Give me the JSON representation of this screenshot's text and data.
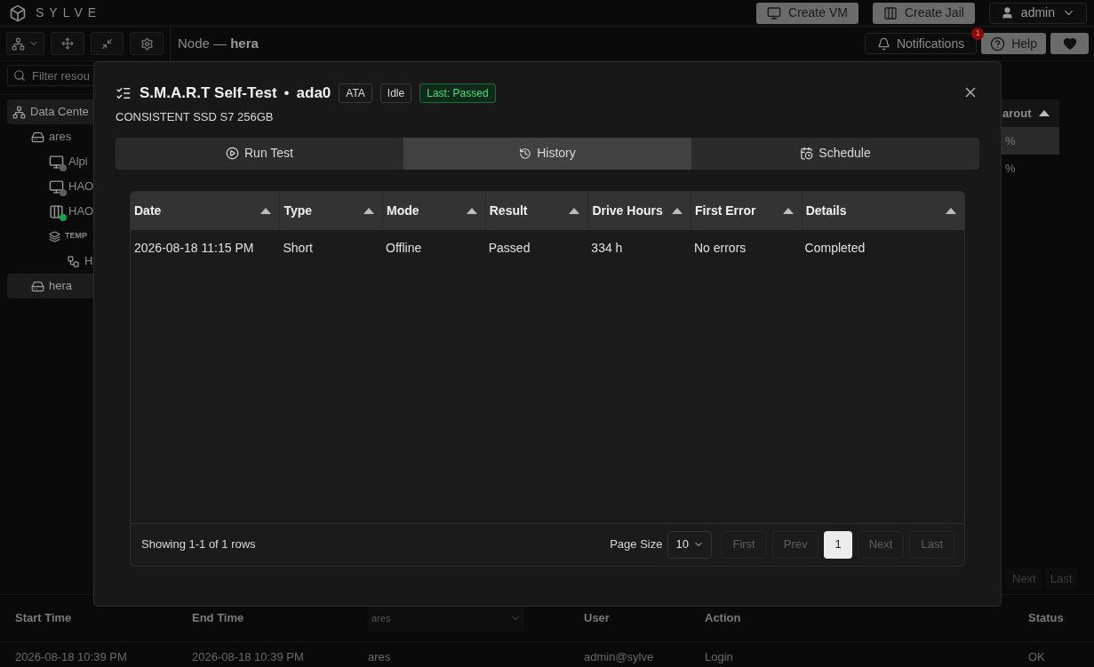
{
  "brand": "SYLVE",
  "header_buttons": [
    {
      "kind": "vm",
      "label": "Create VM"
    },
    {
      "kind": "jail",
      "label": "Create Jail"
    },
    {
      "kind": "user",
      "label": "admin"
    }
  ],
  "breadcrumb": "Node — **hera**",
  "toolbar_right": {
    "notifications": "Notifications",
    "badge": "1",
    "help": "Help"
  },
  "sidebar": {
    "filter_placeholder": "Filter resou",
    "tree": [
      {
        "kind": "datacenter",
        "label": "Data Cente",
        "selected": true,
        "children": [
          {
            "kind": "node",
            "label": "ares",
            "selected": false,
            "children": [
              {
                "kind": "vm",
                "label": "Alpi",
                "selected": false,
                "color": "#5f5f5f"
              },
              {
                "kind": "vm",
                "label": "HAO",
                "selected": false,
                "color": "#5f5f5f"
              },
              {
                "kind": "jail",
                "label": "HAO",
                "selected": false,
                "color": "#16a34a"
              },
              {
                "kind": "template",
                "label": "TEMP",
                "selected": false,
                "children": [
                  {
                    "kind": "network",
                    "label": "H",
                    "selected": false
                  }
                ]
              }
            ]
          },
          {
            "kind": "node",
            "label": "hera",
            "selected": true
          }
        ]
      }
    ]
  },
  "right_panel": {
    "column": "arout",
    "cells": [
      {
        "text": "%",
        "selected": true
      },
      {
        "text": "%",
        "selected": false
      }
    ],
    "pager": [
      {
        "label": "Next",
        "disabled": true
      },
      {
        "label": "Last",
        "disabled": true
      }
    ]
  },
  "bottom_table": {
    "columns": [
      {
        "kind": "text",
        "label": "Start Time"
      },
      {
        "kind": "text",
        "label": "End Time"
      },
      {
        "kind": "select",
        "label": "ares"
      },
      {
        "kind": "text",
        "label": "User"
      },
      {
        "kind": "text",
        "label": "Action"
      },
      {
        "kind": "text",
        "label": "Status"
      }
    ],
    "rows": [
      [
        "2026-08-18 10:39 PM",
        "2026-08-18 10:39 PM",
        "ares",
        "admin@sylve",
        "Login",
        "OK"
      ]
    ]
  },
  "dialog": {
    "title": "S.M.A.R.T Self-Test",
    "separator": "•",
    "disk": "ada0",
    "badges": [
      {
        "kind": "plain",
        "label": "ATA"
      },
      {
        "kind": "plain",
        "label": "Idle"
      },
      {
        "kind": "success",
        "label": "Last: Passed"
      }
    ],
    "subtitle": "CONSISTENT SSD S7 256GB",
    "tabs": [
      {
        "kind": "run",
        "label": "Run Test",
        "selected": false
      },
      {
        "kind": "history",
        "label": "History",
        "selected": true
      },
      {
        "kind": "schedule",
        "label": "Schedule",
        "selected": false
      }
    ],
    "table": {
      "columns": [
        "Date",
        "Type",
        "Mode",
        "Result",
        "Drive Hours",
        "First Error",
        "Details"
      ],
      "rows": [
        [
          "2026-08-18 11:15 PM",
          "Short",
          "Offline",
          "Passed",
          "334 h",
          "No errors",
          "Completed"
        ]
      ]
    },
    "footer": {
      "summary": "Showing 1-1 of 1 rows",
      "page_size_label": "Page Size",
      "page_size": "10",
      "pages": [
        {
          "label": "First",
          "selected": false,
          "disabled": true
        },
        {
          "label": "Prev",
          "selected": false,
          "disabled": true
        },
        {
          "label": "1",
          "selected": true,
          "disabled": false
        },
        {
          "label": "Next",
          "selected": false,
          "disabled": true
        },
        {
          "label": "Last",
          "selected": false,
          "disabled": true
        }
      ]
    }
  }
}
